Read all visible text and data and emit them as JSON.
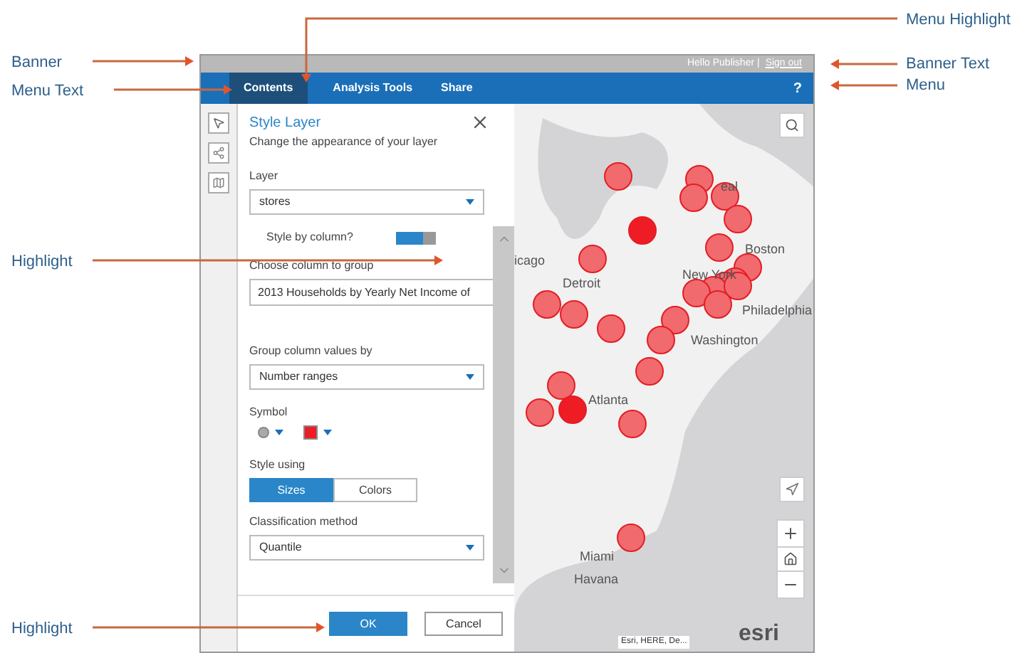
{
  "annotations": [
    {
      "label": "Banner"
    },
    {
      "label": "Menu Text"
    },
    {
      "label": "Highlight"
    },
    {
      "label": "Highlight"
    },
    {
      "label": "Menu Highlight"
    },
    {
      "label": "Banner Text"
    },
    {
      "label": "Menu"
    }
  ],
  "banner": {
    "greeting": "Hello Publisher |",
    "link": "Sign out"
  },
  "menu": {
    "tabs": [
      {
        "label": "Contents",
        "selected": true
      },
      {
        "label": "Analysis Tools",
        "selected": false
      },
      {
        "label": "Share",
        "selected": false
      }
    ],
    "help": "?"
  },
  "panel": {
    "title": "Style Layer",
    "subtitle": "Change the appearance of your layer",
    "layer": {
      "label": "Layer",
      "value": "stores"
    },
    "style_by_column": {
      "label": "Style by column?",
      "on": true
    },
    "group_column": {
      "label": "Choose column to group",
      "value": "2013 Households by Yearly Net Income of"
    },
    "group_values": {
      "label": "Group column values by",
      "value": "Number ranges"
    },
    "symbol": {
      "label": "Symbol",
      "color": "#ee1c25"
    },
    "style_using": {
      "label": "Style using",
      "options": [
        {
          "label": "Sizes",
          "selected": true
        },
        {
          "label": "Colors",
          "selected": false
        }
      ]
    },
    "classification": {
      "label": "Classification method",
      "value": "Quantile"
    },
    "buttons": [
      {
        "label": "OK",
        "kind": "primary"
      },
      {
        "label": "Cancel",
        "kind": "secondary"
      }
    ]
  },
  "map": {
    "labels": [
      {
        "text": "icago"
      },
      {
        "text": "Detroit"
      },
      {
        "text": "eal"
      },
      {
        "text": "Boston"
      },
      {
        "text": "New York"
      },
      {
        "text": "Philadelphia"
      },
      {
        "text": "Washington"
      },
      {
        "text": "Atlanta"
      },
      {
        "text": "Miami"
      },
      {
        "text": "Havana"
      }
    ],
    "attribution": "Esri, HERE, De...",
    "logo": "esri"
  }
}
